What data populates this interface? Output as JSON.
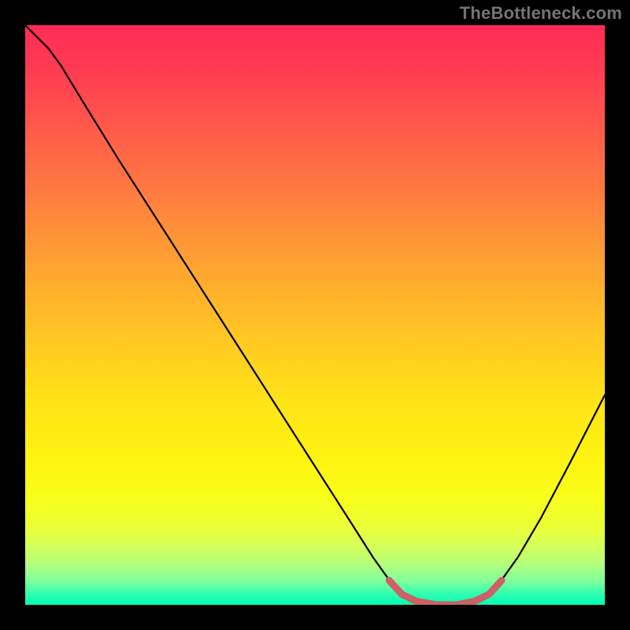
{
  "watermark": "TheBottleneck.com",
  "chart_data": {
    "type": "line",
    "title": "",
    "xlabel": "",
    "ylabel": "",
    "xlim": [
      0,
      1
    ],
    "ylim": [
      0,
      1
    ],
    "gradient_stops": [
      {
        "pos": 0.0,
        "color": "#ff2b56"
      },
      {
        "pos": 0.08,
        "color": "#ff3c52"
      },
      {
        "pos": 0.18,
        "color": "#ff5a4a"
      },
      {
        "pos": 0.3,
        "color": "#ff7f3f"
      },
      {
        "pos": 0.42,
        "color": "#ffa531"
      },
      {
        "pos": 0.54,
        "color": "#ffc823"
      },
      {
        "pos": 0.65,
        "color": "#ffe317"
      },
      {
        "pos": 0.75,
        "color": "#fff40f"
      },
      {
        "pos": 0.82,
        "color": "#f8ff1c"
      },
      {
        "pos": 0.87,
        "color": "#e9ff3a"
      },
      {
        "pos": 0.9,
        "color": "#d3ff5b"
      },
      {
        "pos": 0.93,
        "color": "#b3ff7c"
      },
      {
        "pos": 0.96,
        "color": "#7dff9d"
      },
      {
        "pos": 0.98,
        "color": "#33ffb1"
      },
      {
        "pos": 1.0,
        "color": "#00ffb3"
      }
    ],
    "series": [
      {
        "name": "black-curve",
        "color": "#000000",
        "width": 2,
        "points": [
          {
            "x": 0.0,
            "y": 1.0
          },
          {
            "x": 0.04,
            "y": 0.96
          },
          {
            "x": 0.062,
            "y": 0.93
          },
          {
            "x": 0.097,
            "y": 0.872
          },
          {
            "x": 0.16,
            "y": 0.77
          },
          {
            "x": 0.24,
            "y": 0.645
          },
          {
            "x": 0.32,
            "y": 0.52
          },
          {
            "x": 0.4,
            "y": 0.395
          },
          {
            "x": 0.48,
            "y": 0.27
          },
          {
            "x": 0.56,
            "y": 0.145
          },
          {
            "x": 0.6,
            "y": 0.082
          },
          {
            "x": 0.63,
            "y": 0.04
          },
          {
            "x": 0.655,
            "y": 0.015
          },
          {
            "x": 0.68,
            "y": 0.004
          },
          {
            "x": 0.71,
            "y": 0.0
          },
          {
            "x": 0.74,
            "y": 0.0
          },
          {
            "x": 0.77,
            "y": 0.004
          },
          {
            "x": 0.795,
            "y": 0.015
          },
          {
            "x": 0.82,
            "y": 0.04
          },
          {
            "x": 0.85,
            "y": 0.082
          },
          {
            "x": 0.89,
            "y": 0.15
          },
          {
            "x": 0.94,
            "y": 0.245
          },
          {
            "x": 1.0,
            "y": 0.362
          }
        ]
      },
      {
        "name": "red-highlight",
        "color": "#cc6166",
        "width": 9,
        "points": [
          {
            "x": 0.628,
            "y": 0.042
          },
          {
            "x": 0.65,
            "y": 0.018
          },
          {
            "x": 0.675,
            "y": 0.006
          },
          {
            "x": 0.71,
            "y": 0.0
          },
          {
            "x": 0.745,
            "y": 0.0
          },
          {
            "x": 0.775,
            "y": 0.006
          },
          {
            "x": 0.8,
            "y": 0.018
          },
          {
            "x": 0.822,
            "y": 0.042
          }
        ]
      }
    ]
  }
}
